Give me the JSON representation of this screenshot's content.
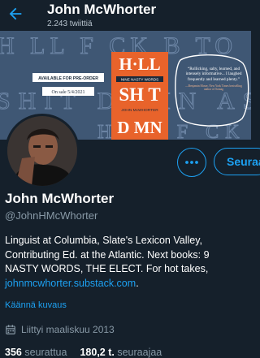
{
  "header": {
    "title": "John McWhorter",
    "subtitle": "2.243 twiittiä"
  },
  "banner": {
    "bg_text_line1": "H LL F CK B TO",
    "bg_text_line2": "SHIT DAMN AS",
    "book_title_1": "H·LL",
    "book_title_2": "SH T",
    "book_title_3": "D MN",
    "book_subtitle": "NINE NASTY WORDS",
    "book_author": "JOHN McWHORTER",
    "preorder_label": "AVAILABLE FOR PRE-ORDER",
    "onsale_label": "On sale 5/4/2021",
    "quote": "“Rollicking, salty, learned, and intensely informative... I laughed frequently and learned plenty.”",
    "quote_attrib": "—Benjamin Moser, New York Times bestselling author of Sontag"
  },
  "profile": {
    "name": "John McWhorter",
    "handle": "@JohnHMcWhorter",
    "bio_lines": [
      "Linguist at Columbia, Slate's Lexicon Valley,",
      "Contributing Ed. at the Atlantic. Next books: 9",
      "NASTY WORDS, THE ELECT. For hot takes,"
    ],
    "bio_link": "johnmcwhorter.substack.com",
    "bio_link_suffix": ".",
    "translate": "Käännä kuvaus",
    "joined": "Liittyi maaliskuu 2013",
    "following_count": "356",
    "following_label": "seurattua",
    "followers_count": "180,2 t.",
    "followers_label": "seuraajaa"
  },
  "buttons": {
    "follow_label": "Seuraa"
  },
  "colors": {
    "background": "#15202b",
    "accent": "#1da1f2",
    "muted": "#8899a6",
    "banner": "#3f5774",
    "book_orange": "#e8632b"
  },
  "icons": {
    "back": "arrow-left-icon",
    "more": "more-horizontal-icon",
    "calendar": "calendar-icon"
  }
}
